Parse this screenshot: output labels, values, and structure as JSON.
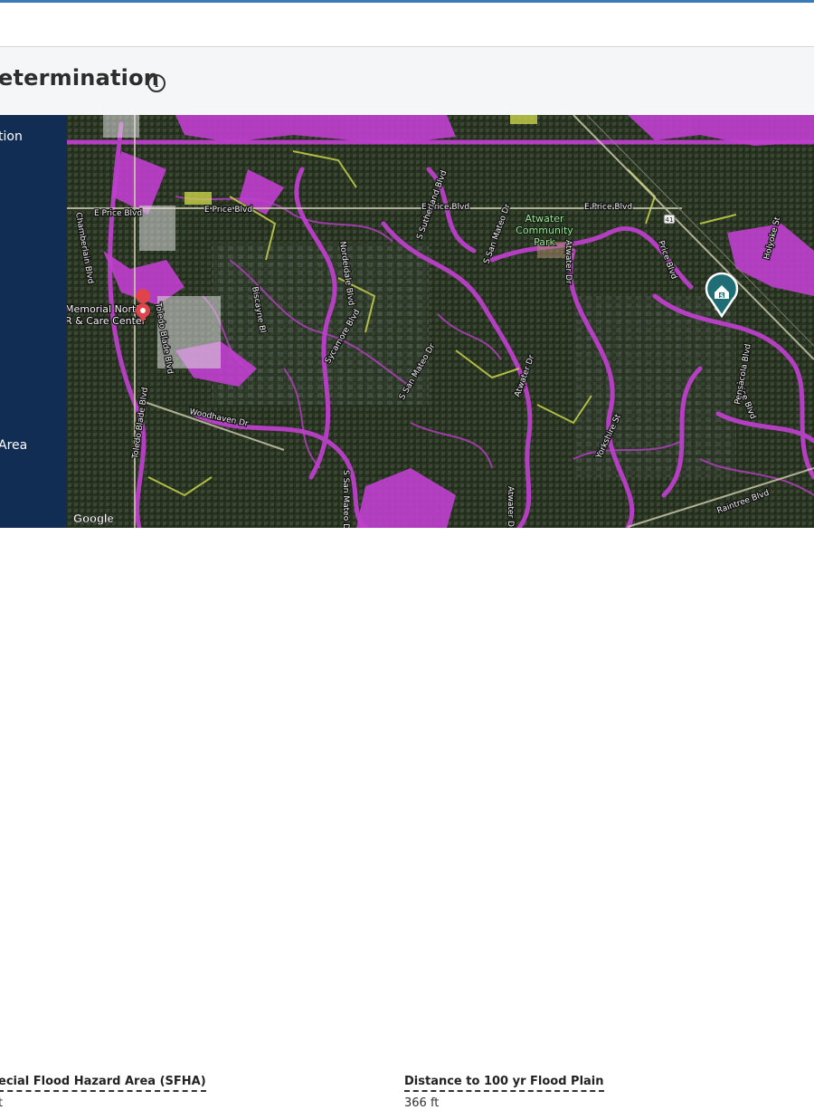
{
  "header": {
    "title": "etermination",
    "info_icon": "info-icon"
  },
  "sidebar": {
    "items": [
      {
        "label": "tion"
      },
      {
        "label": "Area"
      }
    ]
  },
  "map": {
    "streets": [
      "E Price Blvd",
      "E Price Blvd",
      "E Price Blvd",
      "E Price Blvd",
      "Price Blvd",
      "Price Blvd",
      "Toledo Blade Blvd",
      "Toledo Blade Blvd",
      "Chamberlain Blvd",
      "Nordeidale Blvd",
      "Biscayne Bl",
      "Sycamore Blvd",
      "S Sutherland Blvd",
      "S San Mateo Dr",
      "S San Mateo Dr",
      "S San Mateo Dr",
      "Atwater Dr",
      "Atwater Dr",
      "Atwater Dr",
      "Woodhaven Dr",
      "Yorkshire St",
      "Raintree Blvd",
      "Pensacola Blvd",
      "Holyoke St"
    ],
    "pois": [
      {
        "line1": "Memorial North",
        "line2": "R & Care Center"
      },
      {
        "line1": "Atwater",
        "line2": "Community",
        "line3": "Park"
      }
    ],
    "route_shields": [
      "41",
      "41"
    ],
    "attribution": "Google",
    "property_marker_icon": "home-dollar-pin-icon",
    "poi_marker_icon": "location-pin-icon",
    "colors": {
      "flood_zone": "#c13fd0",
      "moderate_zone": "#c9d34a",
      "marker": "#1f6e76",
      "poi_marker": "#e0444b",
      "sidebar": "#112d54"
    }
  },
  "stats": [
    {
      "label": "ecial Flood Hazard Area (SFHA)",
      "value": "t"
    },
    {
      "label": "Distance to 100 yr Flood Plain",
      "value": "366 ft"
    }
  ]
}
